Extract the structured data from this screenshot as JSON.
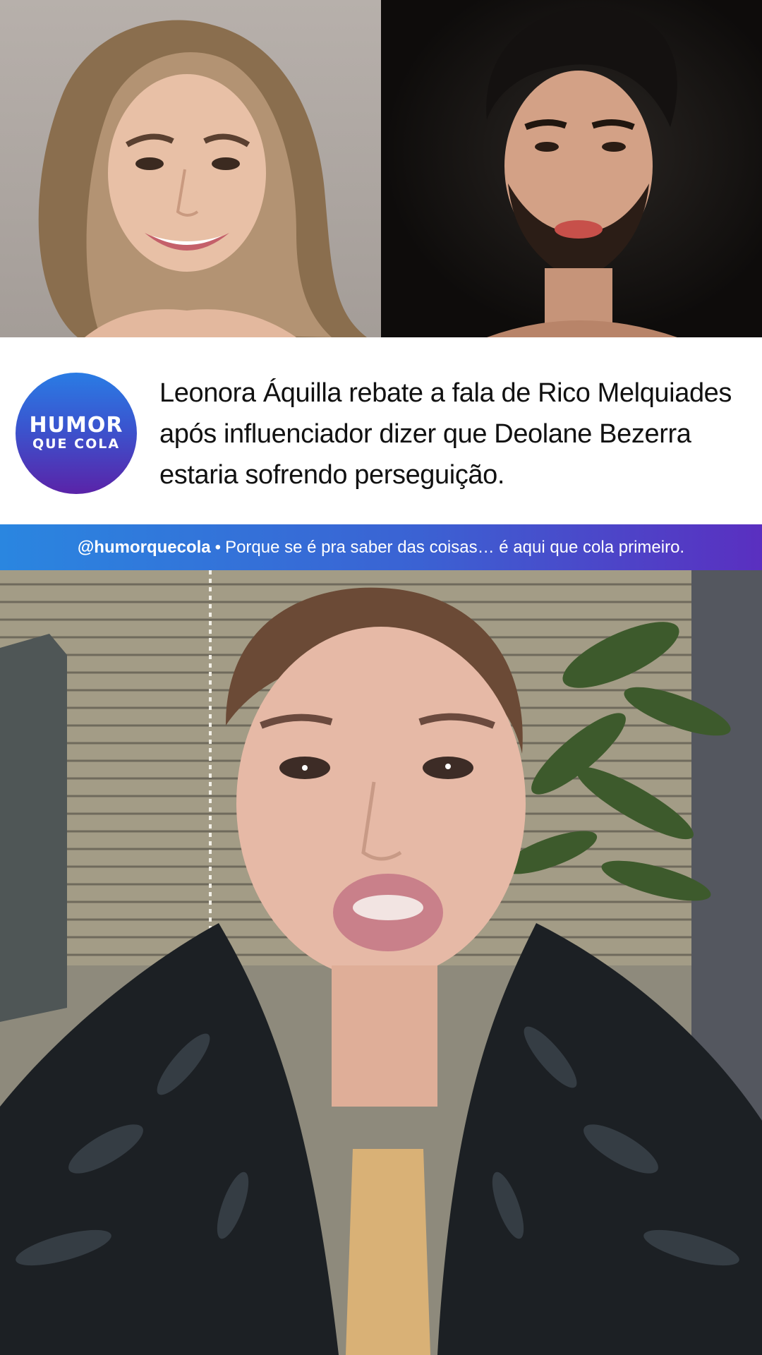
{
  "headline": {
    "text": "Leonora Áquilla rebate a fala de Rico Melquiades após influenciador dizer que Deolane Bezerra estaria sofrendo perseguição."
  },
  "logo": {
    "line1": "HUMOR",
    "line2": "QUE COLA"
  },
  "caption": {
    "handle": "@humorquecola",
    "separator": "•",
    "text": "Porque se é pra saber das coisas… é aqui que cola primeiro."
  },
  "colors": {
    "logo_gradient_top": "#2a7ce4",
    "logo_gradient_bottom": "#5a23a8",
    "caption_bar_left": "#2a86e0",
    "caption_bar_right": "#5a2fc0"
  }
}
